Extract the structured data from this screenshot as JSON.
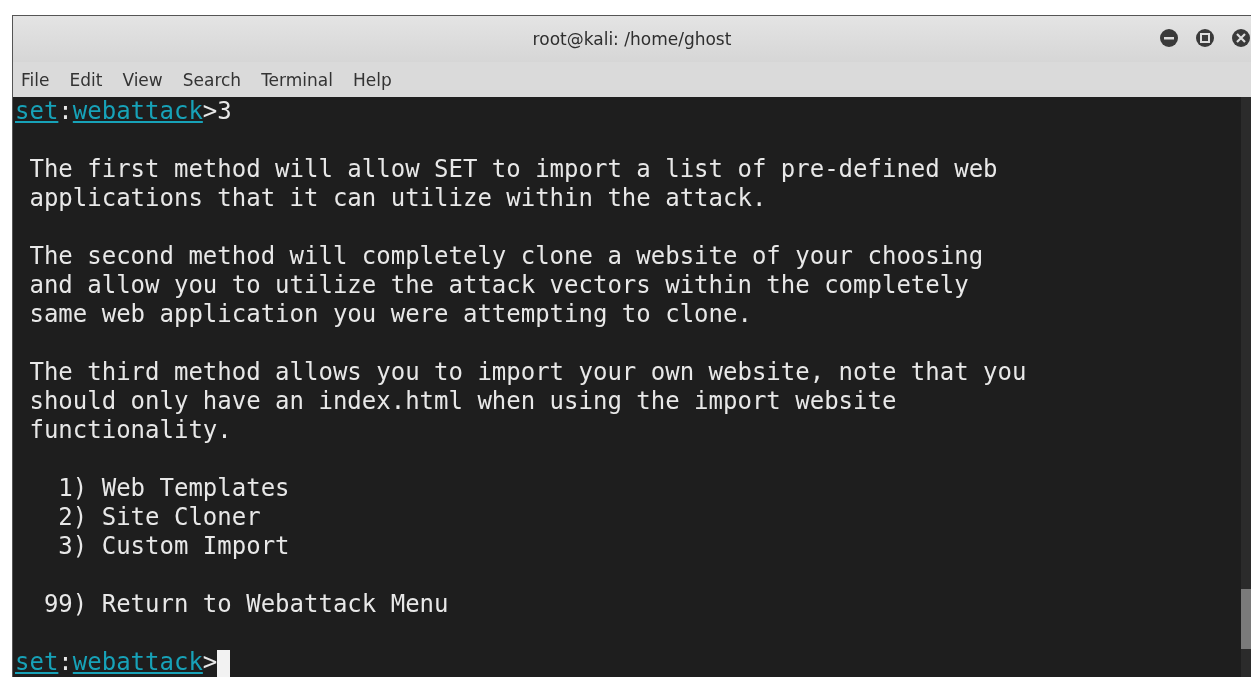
{
  "window": {
    "title": "root@kali: /home/ghost"
  },
  "menu": [
    "File",
    "Edit",
    "View",
    "Search",
    "Terminal",
    "Help"
  ],
  "terminal": {
    "lines": [
      {
        "kind": "prompt",
        "module": "set",
        "separator": ":",
        "submodule": "webattack",
        "symbol": ">",
        "input": "3",
        "cursor": false
      },
      {
        "kind": "blank"
      },
      {
        "kind": "text",
        "text": " The first method will allow SET to import a list of pre-defined web"
      },
      {
        "kind": "text",
        "text": " applications that it can utilize within the attack."
      },
      {
        "kind": "blank"
      },
      {
        "kind": "text",
        "text": " The second method will completely clone a website of your choosing"
      },
      {
        "kind": "text",
        "text": " and allow you to utilize the attack vectors within the completely"
      },
      {
        "kind": "text",
        "text": " same web application you were attempting to clone."
      },
      {
        "kind": "blank"
      },
      {
        "kind": "text",
        "text": " The third method allows you to import your own website, note that you"
      },
      {
        "kind": "text",
        "text": " should only have an index.html when using the import website"
      },
      {
        "kind": "text",
        "text": " functionality."
      },
      {
        "kind": "blank"
      },
      {
        "kind": "text",
        "text": "   1) Web Templates"
      },
      {
        "kind": "text",
        "text": "   2) Site Cloner"
      },
      {
        "kind": "text",
        "text": "   3) Custom Import"
      },
      {
        "kind": "blank"
      },
      {
        "kind": "text",
        "text": "  99) Return to Webattack Menu"
      },
      {
        "kind": "blank"
      },
      {
        "kind": "prompt",
        "module": "set",
        "separator": ":",
        "submodule": "webattack",
        "symbol": ">",
        "cursor": true
      }
    ]
  }
}
